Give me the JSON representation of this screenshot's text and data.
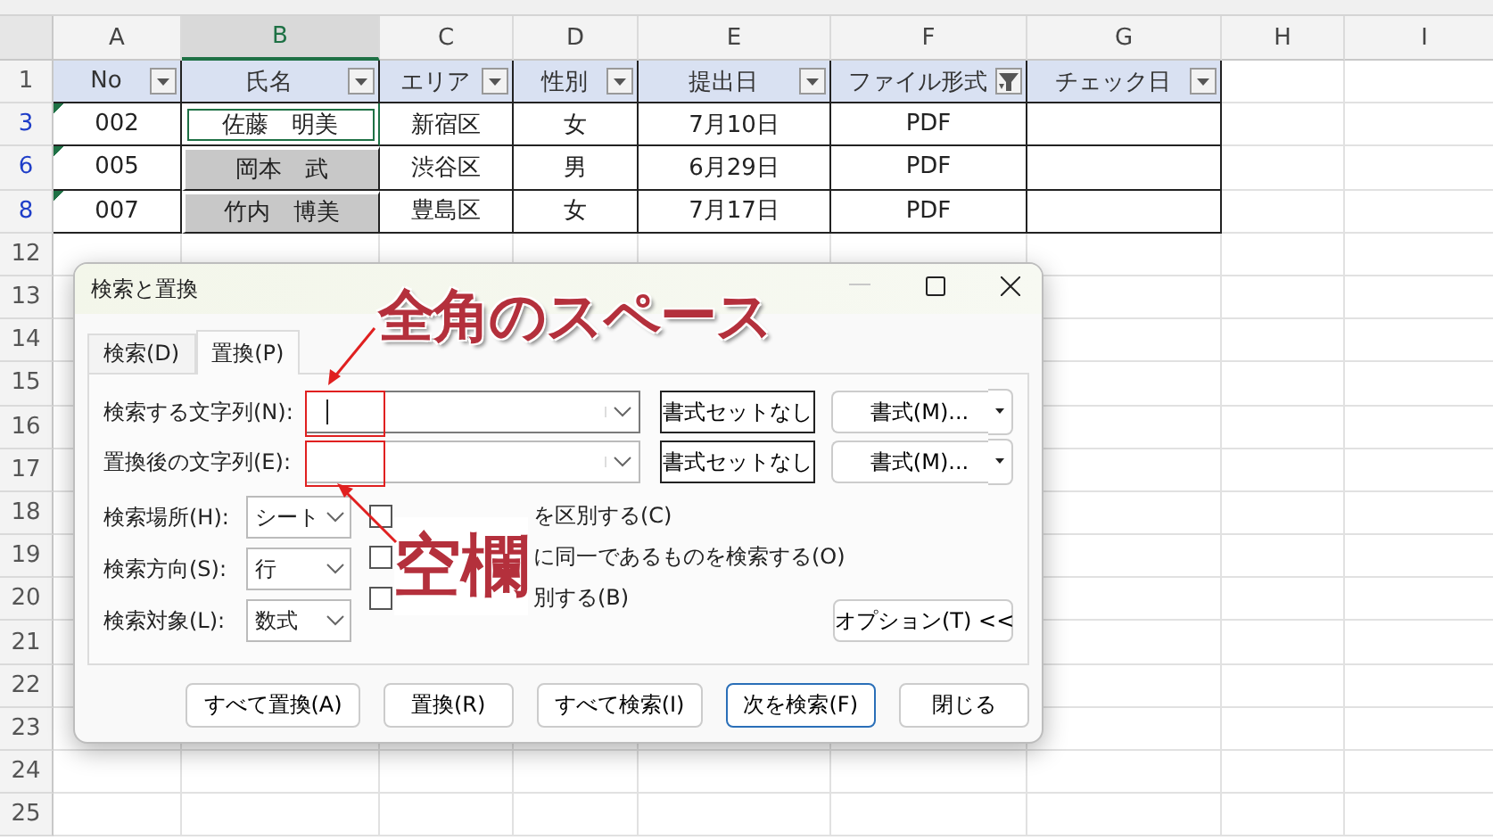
{
  "sheet": {
    "columns": [
      {
        "label": "A",
        "selected": false
      },
      {
        "label": "B",
        "selected": true
      },
      {
        "label": "C",
        "selected": false
      },
      {
        "label": "D",
        "selected": false
      },
      {
        "label": "E",
        "selected": false
      },
      {
        "label": "F",
        "selected": false
      },
      {
        "label": "G",
        "selected": false
      },
      {
        "label": "H",
        "selected": false
      },
      {
        "label": "I",
        "selected": false
      }
    ],
    "header_row": {
      "row": "1",
      "cells": [
        {
          "text": "No",
          "filter_applied": false
        },
        {
          "text": "氏名",
          "filter_applied": false
        },
        {
          "text": "エリア",
          "filter_applied": false
        },
        {
          "text": "性別",
          "filter_applied": false
        },
        {
          "text": "提出日",
          "filter_applied": false
        },
        {
          "text": "ファイル形式",
          "filter_applied": true
        },
        {
          "text": "チェック日",
          "filter_applied": false
        }
      ]
    },
    "rows": [
      {
        "row": "3",
        "filtered": true,
        "cells": [
          {
            "text": "002",
            "error_mark": true,
            "selected": false,
            "highlighted": false
          },
          {
            "text": "佐藤　明美",
            "error_mark": false,
            "selected": true,
            "highlighted": false
          },
          {
            "text": "新宿区",
            "error_mark": false,
            "selected": false,
            "highlighted": false
          },
          {
            "text": "女",
            "error_mark": false,
            "selected": false,
            "highlighted": false
          },
          {
            "text": "7月10日",
            "error_mark": false,
            "selected": false,
            "highlighted": false
          },
          {
            "text": "PDF",
            "error_mark": false,
            "selected": false,
            "highlighted": false
          },
          {
            "error_mark": false,
            "selected": false,
            "highlighted": false
          }
        ]
      },
      {
        "row": "6",
        "filtered": true,
        "cells": [
          {
            "text": "005",
            "error_mark": true,
            "selected": false,
            "highlighted": false
          },
          {
            "text": "岡本　武",
            "error_mark": false,
            "selected": false,
            "highlighted": true
          },
          {
            "text": "渋谷区",
            "error_mark": false,
            "selected": false,
            "highlighted": false
          },
          {
            "text": "男",
            "error_mark": false,
            "selected": false,
            "highlighted": false
          },
          {
            "text": "6月29日",
            "error_mark": false,
            "selected": false,
            "highlighted": false
          },
          {
            "text": "PDF",
            "error_mark": false,
            "selected": false,
            "highlighted": false
          },
          {
            "error_mark": false,
            "selected": false,
            "highlighted": false
          }
        ]
      },
      {
        "row": "8",
        "filtered": true,
        "cells": [
          {
            "text": "007",
            "error_mark": true,
            "selected": false,
            "highlighted": false
          },
          {
            "text": "竹内　博美",
            "error_mark": false,
            "selected": false,
            "highlighted": true
          },
          {
            "text": "豊島区",
            "error_mark": false,
            "selected": false,
            "highlighted": false
          },
          {
            "text": "女",
            "error_mark": false,
            "selected": false,
            "highlighted": false
          },
          {
            "text": "7月17日",
            "error_mark": false,
            "selected": false,
            "highlighted": false
          },
          {
            "text": "PDF",
            "error_mark": false,
            "selected": false,
            "highlighted": false
          },
          {
            "error_mark": false,
            "selected": false,
            "highlighted": false
          }
        ]
      }
    ],
    "blank_rows": [
      "12",
      "13",
      "14",
      "15",
      "16",
      "17",
      "18",
      "19",
      "20",
      "21",
      "22",
      "23",
      "24",
      "25"
    ]
  },
  "dialog": {
    "title": "検索と置換",
    "tabs": [
      {
        "label": "検索(D)",
        "selected": false
      },
      {
        "label": "置換(P)",
        "selected": true
      }
    ],
    "fields": [
      {
        "label": "検索する文字列(N):",
        "has_cursor": true,
        "format_status": "書式セットなし",
        "format_button": "書式(M)..."
      },
      {
        "label": "置換後の文字列(E):",
        "has_cursor": false,
        "format_status": "書式セットなし",
        "format_button": "書式(M)..."
      }
    ],
    "selects": [
      {
        "label": "検索場所(H):",
        "value": "シート"
      },
      {
        "label": "検索方向(S):",
        "value": "行"
      },
      {
        "label": "検索対象(L):",
        "value": "数式"
      }
    ],
    "checkboxes": [
      {
        "label": "を区別する(C)",
        "checked": false
      },
      {
        "label": "に同一であるものを検索する(O)",
        "checked": false
      },
      {
        "label": "別する(B)",
        "checked": false
      }
    ],
    "options_button": "オプション(T) <<",
    "buttons": [
      {
        "label": "すべて置換(A)",
        "default": false
      },
      {
        "label": "置換(R)",
        "default": false
      },
      {
        "label": "すべて検索(I)",
        "default": false
      },
      {
        "label": "次を検索(F)",
        "default": true
      },
      {
        "label": "閉じる",
        "default": false
      }
    ]
  },
  "annotations": [
    {
      "text": "全角のスペース"
    },
    {
      "text": "空欄"
    }
  ]
}
